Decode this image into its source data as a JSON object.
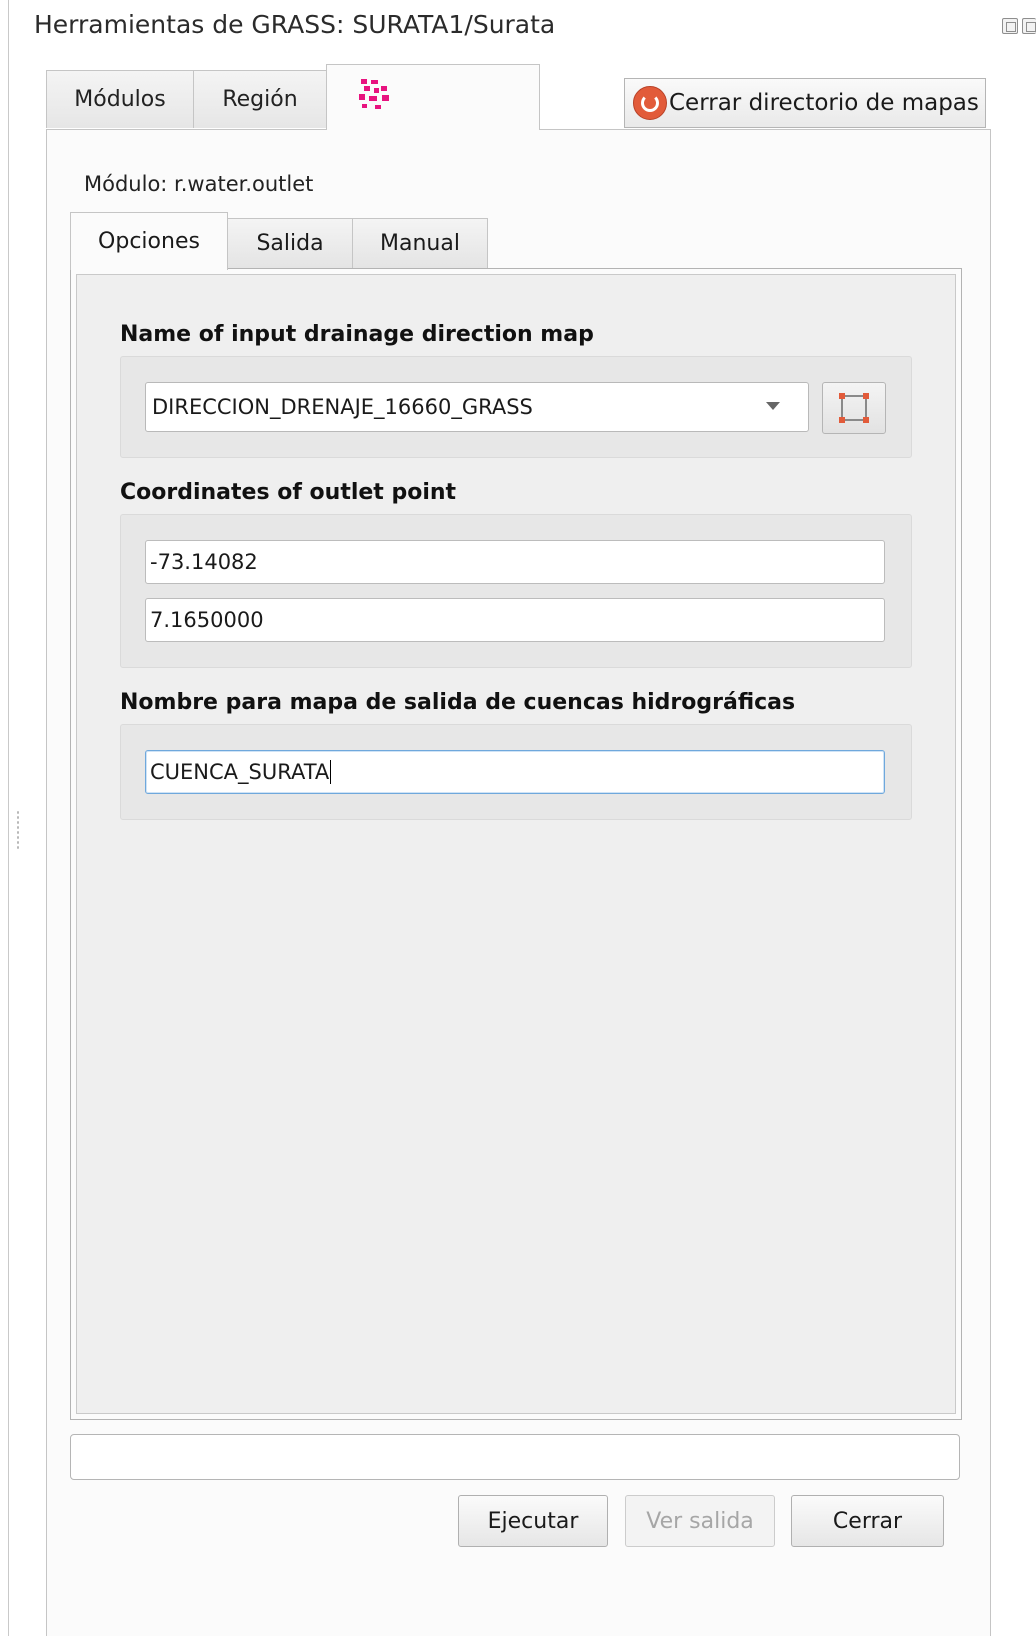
{
  "window": {
    "title": "Herramientas de GRASS: SURATA1/Surata",
    "float_icon": "float-icon",
    "close_icon": "close-icon"
  },
  "outer_tabs": [
    {
      "label": "Módulos"
    },
    {
      "label": "Región"
    },
    {
      "icon": "grass-module-icon",
      "active": true
    }
  ],
  "close_mapset_button": {
    "icon": "power-icon",
    "label": "Cerrar directorio de mapas"
  },
  "module": {
    "label": "Módulo: r.water.outlet"
  },
  "inner_tabs": [
    {
      "label": "Opciones",
      "active": true
    },
    {
      "label": "Salida"
    },
    {
      "label": "Manual"
    }
  ],
  "options": {
    "drainage": {
      "label": "Name of input drainage direction map",
      "value": "DIRECCION_DRENAJE_16660_GRASS",
      "select_icon": "select-from-canvas-icon"
    },
    "coordinates": {
      "label": "Coordinates of outlet point",
      "x": "-73.14082",
      "y": "7.1650000"
    },
    "output": {
      "label": "Nombre para mapa de salida de cuencas hidrográficas",
      "value": "CUENCA_SURATA"
    }
  },
  "status": {
    "text": ""
  },
  "buttons": {
    "run": "Ejecutar",
    "view_output": "Ver salida",
    "close": "Cerrar"
  },
  "colors": {
    "accent_pink": "#e8137f",
    "power_red": "#e25b3a",
    "focus_blue": "#6fa8dc"
  }
}
